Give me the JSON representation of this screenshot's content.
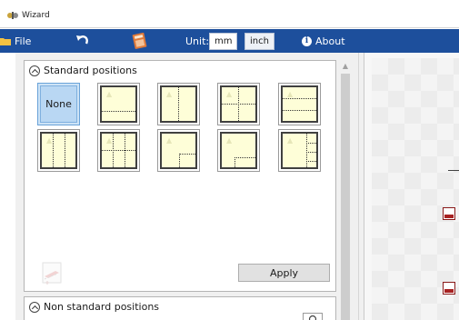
{
  "window": {
    "title": "Wizard"
  },
  "menubar": {
    "file_label": "File",
    "unit_label": "Unit:",
    "units": [
      {
        "label": "mm",
        "active": true
      },
      {
        "label": "inch",
        "active": false
      }
    ],
    "about_label": "About"
  },
  "standard_positions": {
    "header": "Standard positions",
    "tiles": [
      {
        "name": "none",
        "label": "None",
        "selected": true
      },
      {
        "name": "bottom-third-split",
        "label": ""
      },
      {
        "name": "vertical-split",
        "label": ""
      },
      {
        "name": "quadrants",
        "label": ""
      },
      {
        "name": "horizontal-thirds",
        "label": ""
      },
      {
        "name": "vertical-thirds",
        "label": ""
      },
      {
        "name": "grid-six",
        "label": ""
      },
      {
        "name": "bottom-right-corner",
        "label": ""
      },
      {
        "name": "small-bottom-right-box",
        "label": ""
      },
      {
        "name": "right-column-rows",
        "label": ""
      }
    ],
    "apply_label": "Apply"
  },
  "non_standard_positions": {
    "header": "Non standard positions"
  },
  "colors": {
    "menubar": "#1d4f9c",
    "selected_tile": "#cde3f6",
    "tile_fill": "#fefed8"
  }
}
